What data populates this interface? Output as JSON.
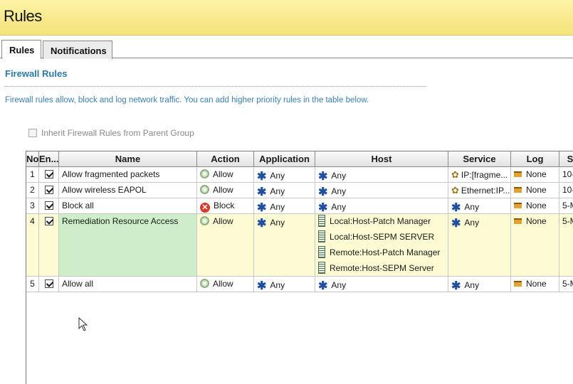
{
  "header": {
    "title": "Rules"
  },
  "tabs": [
    {
      "label": "Rules",
      "active": true
    },
    {
      "label": "Notifications",
      "active": false
    }
  ],
  "section": {
    "title": "Firewall Rules",
    "description": "Firewall rules allow, block and log network traffic. You can add higher priority rules in the table below."
  },
  "inherit": {
    "label": "Inherit Firewall Rules from Parent Group",
    "checked": false,
    "enabled": false
  },
  "table": {
    "columns": [
      "No",
      "En...",
      "Name",
      "Action",
      "Application",
      "Host",
      "Service",
      "Log",
      "S"
    ],
    "rows": [
      {
        "no": "1",
        "enabled": true,
        "name": "Allow fragmented packets",
        "action": "Allow",
        "application": "Any",
        "hosts": [
          "Any"
        ],
        "service": "IP:[fragme...",
        "service_icon": "gear-icon",
        "log": "None",
        "s": "10-"
      },
      {
        "no": "2",
        "enabled": true,
        "name": "Allow wireless EAPOL",
        "action": "Allow",
        "application": "Any",
        "hosts": [
          "Any"
        ],
        "service": "Ethernet:IP...",
        "service_icon": "gear-icon",
        "log": "None",
        "s": "10-"
      },
      {
        "no": "3",
        "enabled": true,
        "name": "Block all",
        "action": "Block",
        "application": "Any",
        "hosts": [
          "Any"
        ],
        "service": "Any",
        "service_icon": "asterisk-icon",
        "log": "None",
        "s": "5-M"
      },
      {
        "no": "4",
        "enabled": true,
        "name": "Remediation Resource Access",
        "action": "Allow",
        "application": "Any",
        "hosts": [
          "Local:Host-Patch Manager",
          "Local:Host-SEPM SERVER",
          "Remote:Host-Patch Manager",
          "Remote:Host-SEPM Server"
        ],
        "service": "Any",
        "service_icon": "asterisk-icon",
        "log": "None",
        "s": "5-M",
        "selected": true
      },
      {
        "no": "5",
        "enabled": true,
        "name": "Allow all",
        "action": "Allow",
        "application": "Any",
        "hosts": [
          "Any"
        ],
        "service": "Any",
        "service_icon": "asterisk-icon",
        "log": "None",
        "s": "5-M"
      }
    ]
  },
  "colors": {
    "header_bg": "#f5e27a",
    "link_blue": "#2a7aa8",
    "selected_row": "#fdfbd4",
    "selected_name": "#cdeec9",
    "block_red": "#d93a2a"
  }
}
